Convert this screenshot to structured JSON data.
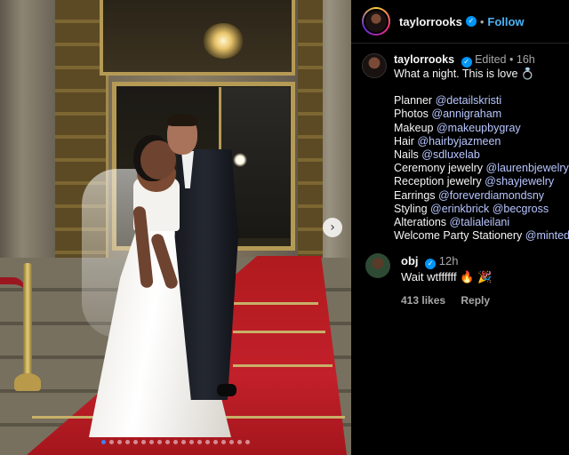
{
  "post": {
    "photo_alt": "wedding photo",
    "carousel": {
      "total": 19,
      "active_index": 0,
      "next_label": "›"
    }
  },
  "header": {
    "username": "taylorrooks",
    "separator": "•",
    "follow_label": "Follow"
  },
  "caption": {
    "username": "taylorrooks",
    "edited": "Edited",
    "separator": "•",
    "time": "16h",
    "headline": "What a night. This is love 💍",
    "credits": [
      {
        "label": "Planner",
        "handles": [
          "@detailskristi"
        ]
      },
      {
        "label": "Photos",
        "handles": [
          "@annigraham"
        ]
      },
      {
        "label": "Makeup",
        "handles": [
          "@makeupbygray"
        ]
      },
      {
        "label": "Hair",
        "handles": [
          "@hairbyjazmeen"
        ]
      },
      {
        "label": "Nails",
        "handles": [
          "@sdluxelab"
        ]
      },
      {
        "label": "Ceremony jewelry",
        "handles": [
          "@laurenbjewelry"
        ]
      },
      {
        "label": "Reception jewelry",
        "handles": [
          "@shayjewelry"
        ]
      },
      {
        "label": "Earrings",
        "handles": [
          "@foreverdiamondsny"
        ]
      },
      {
        "label": "Styling",
        "handles": [
          "@erinkbrick",
          "@becgross"
        ]
      },
      {
        "label": "Alterations",
        "handles": [
          "@talialeilani"
        ]
      },
      {
        "label": "Welcome Party Stationery",
        "handles": [
          "@minted"
        ]
      }
    ]
  },
  "comment": {
    "username": "obj",
    "time": "12h",
    "text": "Wait wtffffff 🔥 🎉",
    "likes": "413 likes",
    "reply_label": "Reply"
  },
  "colors": {
    "link": "#b8c6ff",
    "follow": "#4cb5f9",
    "verified": "#0095f6",
    "carpet": "#c2202a"
  }
}
